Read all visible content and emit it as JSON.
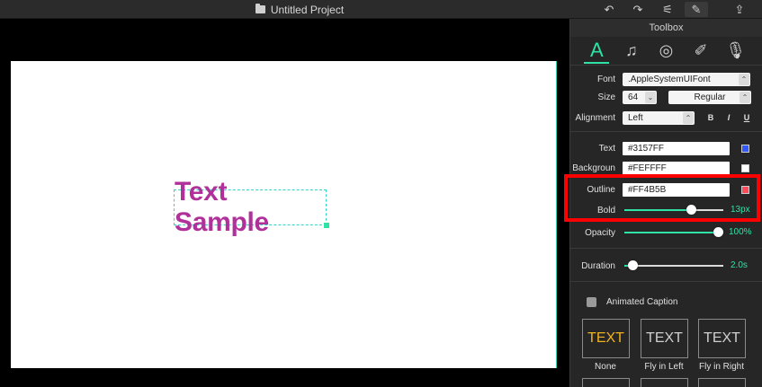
{
  "window": {
    "title": "Untitled Project"
  },
  "toolbar": {
    "undo_icon": "↶",
    "redo_icon": "↷",
    "adjust_icon": "⚟",
    "edit_icon": "✎",
    "share_icon": "⇪"
  },
  "canvas": {
    "text": "Text Sample",
    "text_color": "#b0319a"
  },
  "toolbox": {
    "title": "Toolbox",
    "tools": [
      {
        "name": "text",
        "glyph": "A"
      },
      {
        "name": "music",
        "glyph": "♫"
      },
      {
        "name": "sticker",
        "glyph": "◎"
      },
      {
        "name": "brush",
        "glyph": "✐"
      },
      {
        "name": "mic",
        "glyph": "🎙"
      }
    ],
    "font_label": "Font",
    "font_value": ".AppleSystemUIFont",
    "size_label": "Size",
    "size_value": "64",
    "weight_value": "Regular",
    "alignment_label": "Alignment",
    "alignment_value": "Left",
    "bold_btn": "B",
    "italic_btn": "I",
    "underline_btn": "U",
    "text_label": "Text",
    "text_color": "#3157FF",
    "background_label": "Backgroun",
    "background_color": "#FEFFFF",
    "outline_label": "Outline",
    "outline_color": "#FF4B5B",
    "bold_label": "Bold",
    "bold_value": "13px",
    "bold_fraction": 0.67,
    "opacity_label": "Opacity",
    "opacity_value": "100%",
    "opacity_fraction": 1.0,
    "duration_label": "Duration",
    "duration_value": "2.0s",
    "duration_fraction": 0.08,
    "animated_caption_label": "Animated Caption",
    "animations": [
      {
        "tile_text": "TEXT",
        "label": "None"
      },
      {
        "tile_text": "TEXT",
        "label": "Fly in Left"
      },
      {
        "tile_text": "TEXT",
        "label": "Fly in Right"
      }
    ]
  },
  "colors": {
    "accent": "#2fe3a5",
    "text_swatch": "#3157FF",
    "background_swatch": "#FEFFFF",
    "outline_swatch": "#FF4B5B",
    "highlight": "#ff0000"
  }
}
